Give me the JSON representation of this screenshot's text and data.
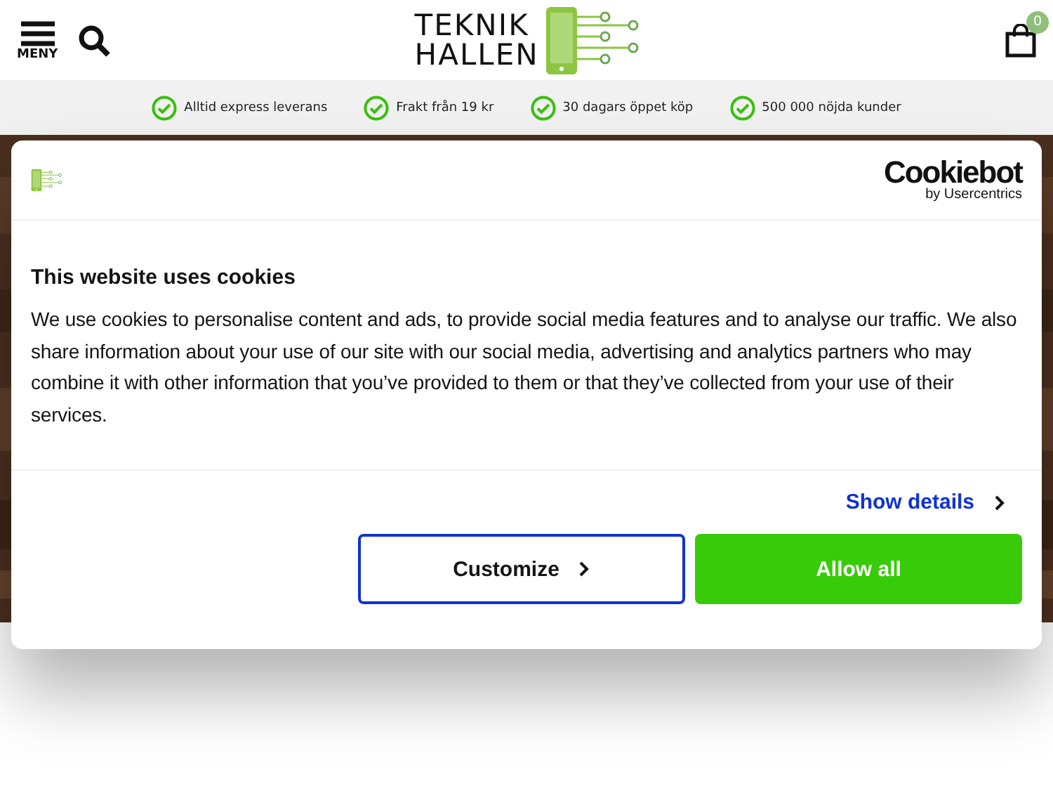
{
  "header": {
    "menu_label": "MENY",
    "logo": {
      "line_1": "TEKNIK",
      "line_2": "HALLEN"
    },
    "cart_count": "0"
  },
  "usp_bar": [
    "Alltid express leverans",
    "Frakt från 19 kr",
    "30 dagars öppet köp",
    "500 000 nöjda kunder"
  ],
  "cookie_dialog": {
    "brand": {
      "name": "Cookiebot",
      "tagline": "by Usercentrics"
    },
    "title": "This website uses cookies",
    "body": "We use cookies to personalise content and ads, to provide social media features and to analyse our traffic. We also share information about your use of our site with our social media, advertising and analytics partners who may combine it with other information that you’ve provided to them or that they’ve collected from your use of their services.",
    "details_link": "Show details",
    "buttons": [
      {
        "label": "Customize",
        "kind": "outline"
      },
      {
        "label": "Allow all",
        "kind": "primary"
      }
    ]
  }
}
